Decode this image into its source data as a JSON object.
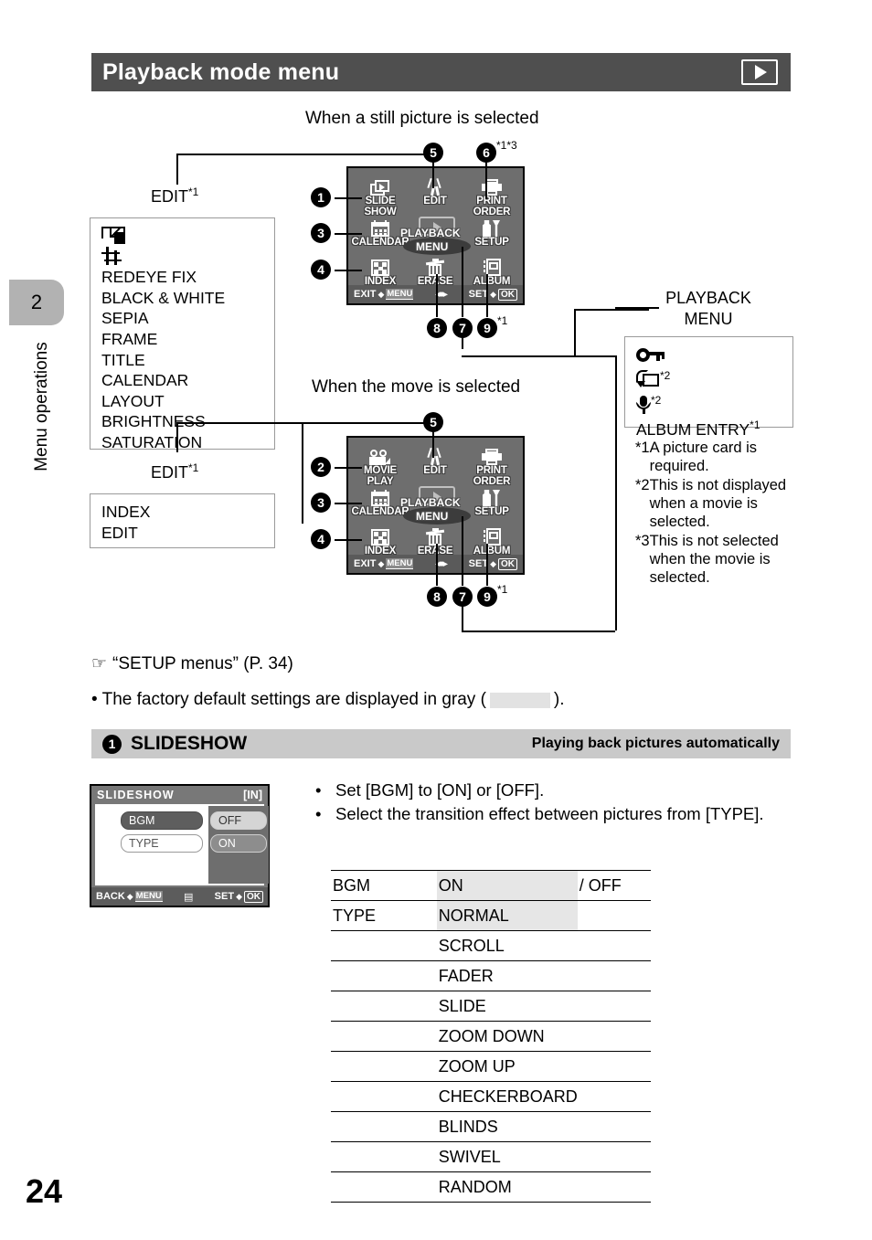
{
  "header": {
    "title": "Playback mode menu",
    "mode_icon": "playback-icon"
  },
  "rail": {
    "chapter_number": "2",
    "chapter_label": "Menu operations",
    "page_number": "24"
  },
  "diagram": {
    "still_caption": "When a still picture is selected",
    "movie_caption": "When the move is selected",
    "edit_label": "EDIT",
    "edit_sup": "*1",
    "edit_still_items": [
      "icon-resize",
      "icon-crop",
      "REDEYE FIX",
      "BLACK & WHITE",
      "SEPIA",
      "FRAME",
      "TITLE",
      "CALENDAR",
      "LAYOUT",
      "BRIGHTNESS",
      "SATURATION"
    ],
    "edit_movie_items": [
      "INDEX",
      "EDIT"
    ],
    "playback_menu_label_line1": "PLAYBACK",
    "playback_menu_label_line2": "MENU",
    "playback_menu_items": [
      {
        "text": "",
        "icon": "key-icon",
        "sup": ""
      },
      {
        "text": "",
        "icon": "rotate-icon",
        "sup": "*2"
      },
      {
        "text": "",
        "icon": "mic-icon",
        "sup": "*2"
      },
      {
        "text": "ALBUM ENTRY",
        "icon": "",
        "sup": "*1"
      }
    ],
    "bullets_still": [
      "1",
      "3",
      "4",
      "5",
      "6",
      "8",
      "7",
      "9"
    ],
    "bullets_movie": [
      "2",
      "3",
      "4",
      "5",
      "8",
      "7",
      "9"
    ],
    "bullet6_sup": "*1*3",
    "bullet9_sup": "*1",
    "notes": [
      {
        "mark": "*1",
        "text": "A picture card is required."
      },
      {
        "mark": "*2",
        "text": "This is not displayed when a movie is selected."
      },
      {
        "mark": "*3",
        "text": "This is not selected when the movie is selected."
      }
    ]
  },
  "lcd_still": {
    "cells": [
      {
        "icon": "slideshow-icon",
        "line1": "SLIDE",
        "line2": "SHOW"
      },
      {
        "icon": "edit-icon",
        "line1": "EDIT",
        "line2": ""
      },
      {
        "icon": "print-order-icon",
        "line1": "PRINT",
        "line2": "ORDER"
      },
      {
        "icon": "calendar-icon",
        "line1": "CALENDAR",
        "line2": ""
      },
      {
        "icon": "playback-menu-icon",
        "line1": "",
        "line2": ""
      },
      {
        "icon": "setup-icon",
        "line1": "SETUP",
        "line2": ""
      },
      {
        "icon": "index-icon",
        "line1": "INDEX",
        "line2": ""
      },
      {
        "icon": "erase-icon",
        "line1": "ERASE",
        "line2": ""
      },
      {
        "icon": "album-icon",
        "line1": "ALBUM",
        "line2": ""
      }
    ],
    "bottom_left": "EXIT",
    "bottom_left_key": "MENU",
    "bottom_right": "SET",
    "bottom_right_key": "OK"
  },
  "lcd_movie": {
    "cells": [
      {
        "icon": "movie-play-icon",
        "line1": "MOVIE",
        "line2": "PLAY"
      },
      {
        "icon": "edit-icon",
        "line1": "EDIT",
        "line2": ""
      },
      {
        "icon": "print-order-icon",
        "line1": "PRINT",
        "line2": "ORDER"
      },
      {
        "icon": "calendar-icon",
        "line1": "CALENDAR",
        "line2": ""
      },
      {
        "icon": "playback-menu-icon",
        "line1": "",
        "line2": ""
      },
      {
        "icon": "setup-icon",
        "line1": "SETUP",
        "line2": ""
      },
      {
        "icon": "index-icon",
        "line1": "INDEX",
        "line2": ""
      },
      {
        "icon": "erase-icon",
        "line1": "ERASE",
        "line2": ""
      },
      {
        "icon": "album-icon",
        "line1": "ALBUM",
        "line2": ""
      }
    ],
    "bottom_left": "EXIT",
    "bottom_left_key": "MENU",
    "bottom_right": "SET",
    "bottom_right_key": "OK"
  },
  "midtext": {
    "setup_ref": "“SETUP menus” (P. 34)",
    "default_note_a": "• The factory default settings are displayed in gray (",
    "default_note_b": ")."
  },
  "section": {
    "number": "1",
    "title": "SLIDESHOW",
    "subtitle": "Playing back pictures automatically"
  },
  "slideshow_lcd": {
    "title": "SLIDESHOW",
    "card": "[IN]",
    "item_bgm": "BGM",
    "item_type": "TYPE",
    "opt_off": "OFF",
    "opt_on": "ON",
    "bottom_left": "BACK",
    "bottom_left_key": "MENU",
    "bottom_right": "SET",
    "bottom_right_key": "OK"
  },
  "instructions": [
    "Set [BGM] to [ON] or [OFF].",
    "Select the transition effect between pictures from [TYPE]."
  ],
  "table": {
    "rows": [
      {
        "label": "BGM",
        "value": "ON",
        "extra": "/ OFF",
        "highlight": true
      },
      {
        "label": "TYPE",
        "value": "NORMAL",
        "extra": "",
        "highlight": true
      },
      {
        "label": "",
        "value": "SCROLL",
        "extra": "",
        "highlight": false
      },
      {
        "label": "",
        "value": "FADER",
        "extra": "",
        "highlight": false
      },
      {
        "label": "",
        "value": "SLIDE",
        "extra": "",
        "highlight": false
      },
      {
        "label": "",
        "value": "ZOOM DOWN",
        "extra": "",
        "highlight": false
      },
      {
        "label": "",
        "value": "ZOOM UP",
        "extra": "",
        "highlight": false
      },
      {
        "label": "",
        "value": "CHECKERBOARD",
        "extra": "",
        "highlight": false
      },
      {
        "label": "",
        "value": "BLINDS",
        "extra": "",
        "highlight": false
      },
      {
        "label": "",
        "value": "SWIVEL",
        "extra": "",
        "highlight": false
      },
      {
        "label": "",
        "value": "RANDOM",
        "extra": "",
        "highlight": false
      }
    ]
  },
  "colors": {
    "header_bg": "#4f4f4f",
    "band_bg": "#c9c9c9",
    "tab_bg": "#b2b2b2",
    "highlight": "#e6e6e6",
    "lcd_bg": "#6e6e6e"
  }
}
